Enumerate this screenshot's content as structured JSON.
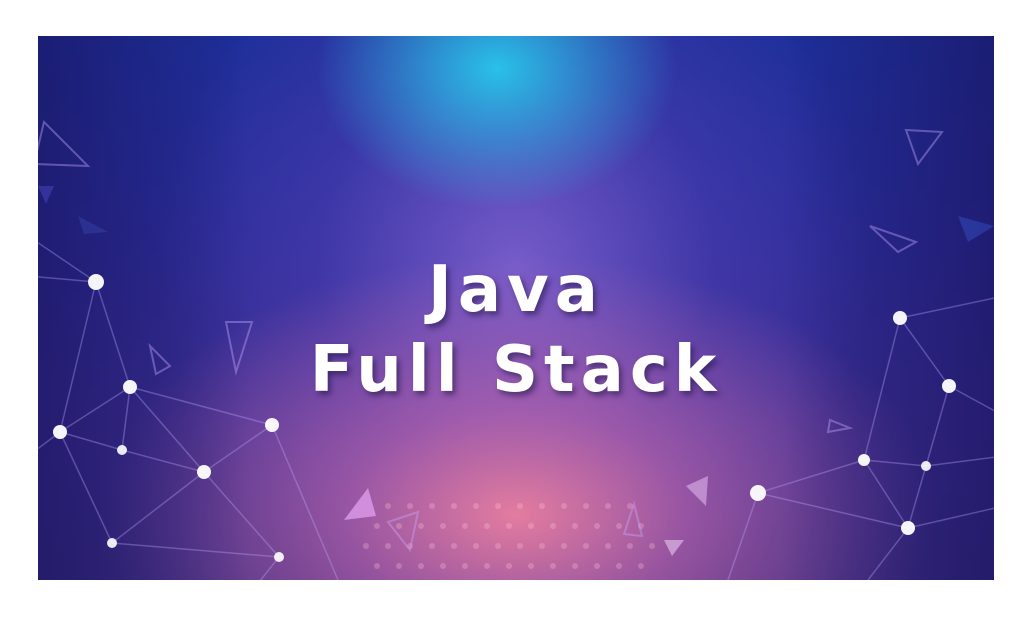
{
  "banner": {
    "title_line1": "Java",
    "title_line2": "Full Stack"
  },
  "colors": {
    "background_top": "#1d2f9a",
    "glow_top": "#28c8eb",
    "glow_bottom": "#ec80a0",
    "text": "#ffffff"
  }
}
